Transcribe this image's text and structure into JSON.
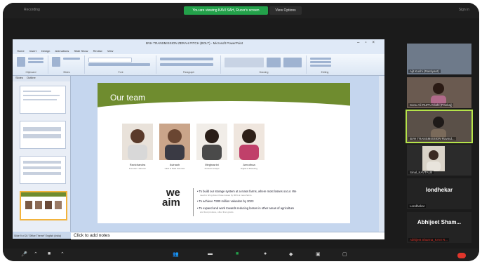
{
  "meeting": {
    "recording_label": "Recording",
    "share_banner": "You are viewing KAVI SAH, Rucer's screen",
    "view_options": "View Options",
    "sign_in": "Sign in"
  },
  "powerpoint": {
    "window_title": "BVH TRANSMISSION ZERAH PITCH (BOLT) - Microsoft PowerPoint",
    "tabs": [
      "Home",
      "Insert",
      "Design",
      "Animations",
      "Slide Show",
      "Review",
      "View"
    ],
    "panel_tabs": [
      "Slides",
      "Outline"
    ],
    "ribbon_groups": [
      "Clipboard",
      "Slides",
      "Font",
      "Paragraph",
      "Drawing",
      "Editing"
    ],
    "status_text": "Slide 9 of 24   \"Office Theme\"   English (India)",
    "notes_placeholder": "Click to add notes"
  },
  "slide": {
    "title": "Our team",
    "team": [
      {
        "name": "Ravichandra",
        "role": "Founder / Director"
      },
      {
        "name": "Avinash",
        "role": "CEO & Data Scientist"
      },
      {
        "name": "Meghasrini",
        "role": "Product Analyst"
      },
      {
        "name": "Amruthaa",
        "role": "Digital & Branding"
      }
    ],
    "we_aim_line1": "we",
    "we_aim_line2": "aim",
    "aims": [
      "• To build our storage system at a mass farms, where most losses occur. We",
      "• To achieve ₹300 million valuation by 2023",
      "• To expand and work towards reducing losses in other areas of agriculture"
    ],
    "aim_notes": [
      "need to bring down those losses by 90% at mass farms.",
      "",
      "and food produce, other than grains."
    ]
  },
  "participants": [
    {
      "name": "Ajit Kushi (Rastiyant)",
      "type": "video"
    },
    {
      "name": "Sonu Ali RUPA Kriahi (Pankaj)",
      "type": "video"
    },
    {
      "name": "BVH TRANSMISSION Ravind...",
      "type": "video",
      "active": true
    },
    {
      "name": "Sinal_KAVTALB",
      "type": "video"
    },
    {
      "name": "Londhekar",
      "big": "londhekar",
      "type": "name"
    },
    {
      "name": "Abhijeet Sharma_KAVI R...",
      "big": "Abhijeet  Sham...",
      "type": "name"
    }
  ],
  "colors": {
    "share_banner": "#23a14a",
    "slide_header": "#6f8c2f",
    "active_speaker": "#b5e34a",
    "end_button": "#e0352b"
  },
  "icons": [
    "microphone-icon",
    "video-icon",
    "participants-icon",
    "chat-icon",
    "share-screen-icon",
    "record-icon",
    "reactions-icon",
    "apps-icon",
    "whiteboard-icon",
    "more-icon"
  ]
}
